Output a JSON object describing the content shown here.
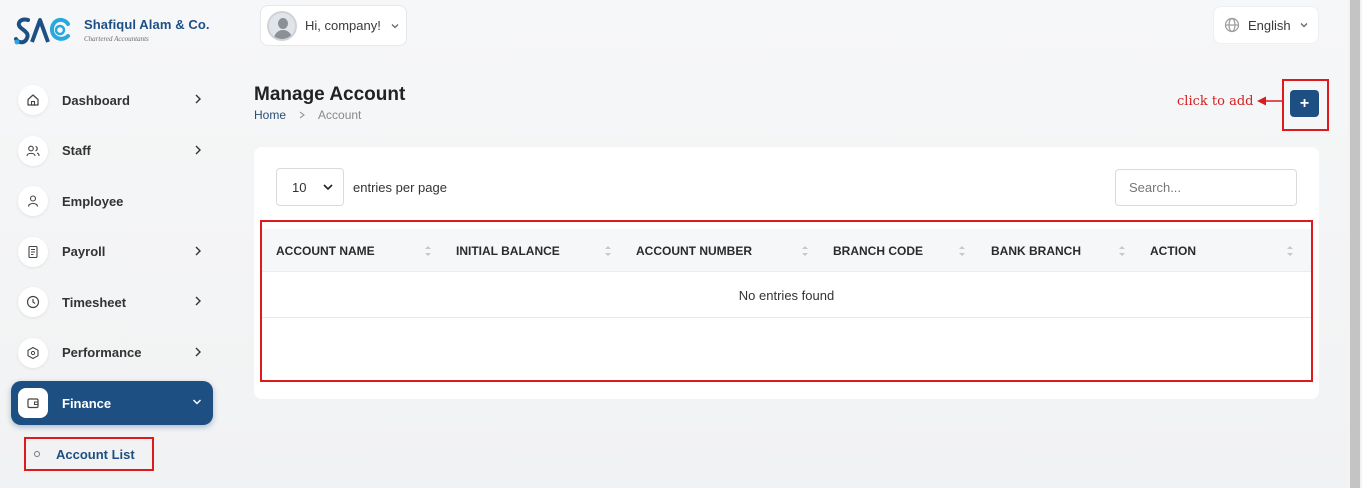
{
  "brand": {
    "name": "Shafiqul Alam & Co.",
    "subtitle": "Chartered Accountants",
    "accent": "#1e4f82"
  },
  "header": {
    "greeting": "Hi, company!",
    "language": "English"
  },
  "sidebar": {
    "items": [
      {
        "label": "Dashboard",
        "icon": "home-icon",
        "has_children": true
      },
      {
        "label": "Staff",
        "icon": "users-icon",
        "has_children": true
      },
      {
        "label": "Employee",
        "icon": "user-icon",
        "has_children": false
      },
      {
        "label": "Payroll",
        "icon": "receipt-icon",
        "has_children": true
      },
      {
        "label": "Timesheet",
        "icon": "clock-icon",
        "has_children": true
      },
      {
        "label": "Performance",
        "icon": "hexagon-icon",
        "has_children": true
      },
      {
        "label": "Finance",
        "icon": "wallet-icon",
        "has_children": true,
        "active": true
      }
    ],
    "sub_item": "Account List"
  },
  "page": {
    "title": "Manage Account",
    "breadcrumb": [
      "Home",
      "Account"
    ],
    "annotation": "click to add",
    "add_label": "+"
  },
  "table": {
    "per_page": "10",
    "per_page_label": "entries per page",
    "search_placeholder": "Search...",
    "columns": [
      "ACCOUNT NAME",
      "INITIAL BALANCE",
      "ACCOUNT NUMBER",
      "BRANCH CODE",
      "BANK BRANCH",
      "ACTION"
    ],
    "empty_text": "No entries found"
  }
}
